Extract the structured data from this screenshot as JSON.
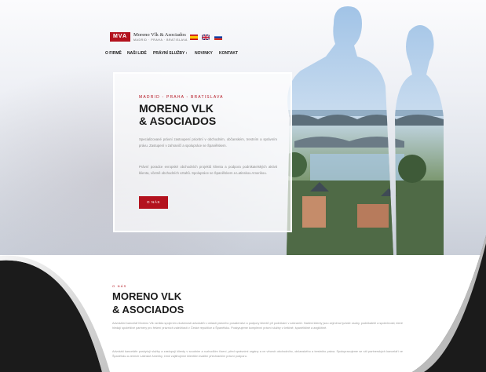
{
  "brand": {
    "mark": "MVA",
    "name": "Moreno Vlk & Asociados",
    "tagline": "MADRID · PRAHA · BRATISLAVA"
  },
  "languages": [
    "es-flag-icon",
    "gb-flag-icon",
    "ru-flag-icon"
  ],
  "nav": [
    "O FIRMĚ",
    "NAŠI LIDÉ",
    "PRÁVNÍ SLUŽBY ›",
    "NOVINKY",
    "KONTAKT"
  ],
  "hero": {
    "eyebrow": "MADRID - PRAHA - BRATISLAVA",
    "title_line1": "MORENO VLK",
    "title_line2": "& ASOCIADOS",
    "text1": "Specializované právní zastoupení prioritní v obchodním, občanském, trestním a správním právu. Zastupení v zahraničí a spolupráce se Španělskem.",
    "text2": "Právní poradce evropské obchodních projektů klienta a podpora podnikatelských aktivit klienta, včetně obchodních vztahů. Spolupráce se Španělskem a Latinskou Amerikou.",
    "button": "O NÁS"
  },
  "about": {
    "eyebrow": "O NÁS",
    "title_line1": "MORENO VLK",
    "title_line2": "& ASOCIADOS",
    "text1": "Advokátní kancelář Moreno Vlk vznikla spojením zkušeností advokátů v oblasti právního poradenství a podpory klientů při podnikání v zahraničí. Našimi klienty jsou zejména fyzické osoby, podnikatelé a společnosti, které hledají spolehlivé partnery pro řešení právních záležitostí v České republice a Španělsku. Poskytujeme komplexní právní služby v češtině, španělštině a angličtině.",
    "text2": "Advokáti kanceláře poskytují služby a zastupují klienty v soudním a rozhodčím řízení, před správními orgány a ve věcech obchodního, občanského a trestního práva. Spolupracujeme se sítí partnerských kanceláří ve Španělsku a zemích Latinské Ameriky, čímž zajišťujeme klientům kvalitní přeshraniční právní podporu."
  },
  "colors": {
    "accent": "#b3121e",
    "heading": "#1a1a1a",
    "body_text": "#8b8b8b",
    "frame": "#1b1b1b"
  }
}
